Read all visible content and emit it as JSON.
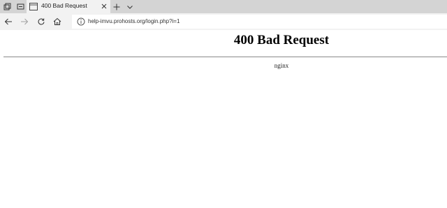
{
  "tab": {
    "title": "400 Bad Request",
    "favicon": "page-icon"
  },
  "tabstrip_icons": [
    "tab-set-aside-icon",
    "tab-preview-icon",
    "new-tab-icon",
    "chevron-down-icon",
    "close-icon"
  ],
  "navigation": {
    "icons": [
      "back-arrow-icon",
      "forward-arrow-icon",
      "refresh-icon",
      "home-icon",
      "info-icon"
    ]
  },
  "address_bar": {
    "url": "help-imvu.prohosts.org/login.php?i=1"
  },
  "page": {
    "heading": "400 Bad Request",
    "server": "nginx"
  },
  "colors": {
    "tabstrip_bg": "#d4d4d4",
    "active_tab_bg": "#f2f2f2",
    "divider": "#8a8a8a"
  }
}
